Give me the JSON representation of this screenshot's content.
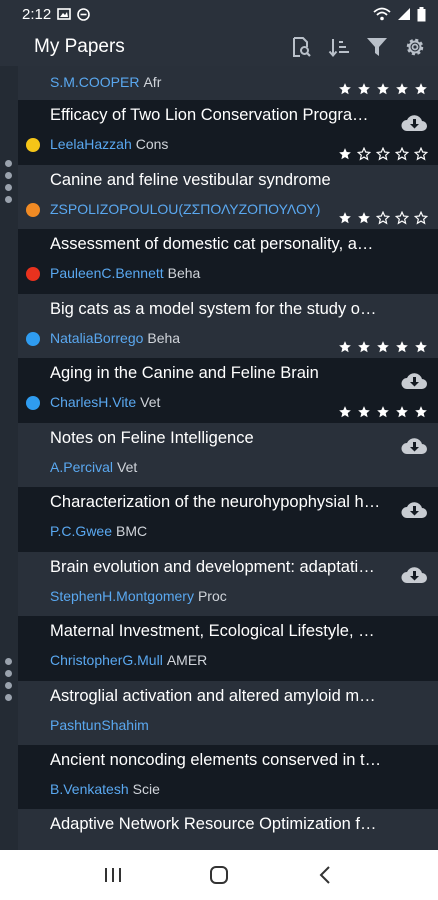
{
  "status_bar": {
    "time": "2:12"
  },
  "app_bar": {
    "title": "My Papers",
    "actions": [
      "search-doc-icon",
      "sort-icon",
      "filter-icon",
      "settings-icon"
    ]
  },
  "papers": [
    {
      "title": "",
      "author": "S.M.COOPER",
      "journal": "Afr",
      "dot": null,
      "rating": 5,
      "download": false
    },
    {
      "title": "Efficacy of Two Lion Conservation Progra…",
      "author": "LeelaHazzah",
      "journal": "Cons",
      "dot": "#f5c518",
      "rating": 1,
      "download": true
    },
    {
      "title": "Canine and feline vestibular syndrome",
      "author": "ZSPOLIZOPOULOU(ΖΣΠΟΛΥΖΟΠΟΥΛΟΥ)",
      "journal": "",
      "dot": "#f08a24",
      "rating": 2,
      "download": false
    },
    {
      "title": "Assessment of domestic cat personality, a…",
      "author": "PauleenC.Bennett",
      "journal": "Beha",
      "dot": "#e8321e",
      "rating": 0,
      "download": false
    },
    {
      "title": "Big cats as a model system for the study o…",
      "author": "NataliaBorrego",
      "journal": "Beha",
      "dot": "#2f9cf0",
      "rating": 5,
      "download": false
    },
    {
      "title": "Aging in the Canine and Feline Brain",
      "author": "CharlesH.Vite",
      "journal": "Vet",
      "dot": "#2f9cf0",
      "rating": 5,
      "download": true
    },
    {
      "title": "Notes on Feline Intelligence",
      "author": "A.Percival",
      "journal": "Vet",
      "dot": null,
      "rating": 0,
      "download": true
    },
    {
      "title": "Characterization of the neurohypophysial h…",
      "author": "P.C.Gwee",
      "journal": "BMC",
      "dot": null,
      "rating": 0,
      "download": true
    },
    {
      "title": "Brain evolution and development: adaptati…",
      "author": "StephenH.Montgomery",
      "journal": "Proc",
      "dot": null,
      "rating": 0,
      "download": true
    },
    {
      "title": "Maternal Investment, Ecological Lifestyle, …",
      "author": "ChristopherG.Mull",
      "journal": "AMER",
      "dot": null,
      "rating": 0,
      "download": false
    },
    {
      "title": "Astroglial activation and altered amyloid m…",
      "author": "PashtunShahim",
      "journal": "",
      "dot": null,
      "rating": 0,
      "download": false
    },
    {
      "title": "Ancient noncoding elements conserved in t…",
      "author": "B.Venkatesh",
      "journal": "Scie",
      "dot": null,
      "rating": 0,
      "download": false
    },
    {
      "title": "Adaptive Network Resource Optimization f…",
      "author": "",
      "journal": "",
      "dot": null,
      "rating": 0,
      "download": false
    }
  ],
  "colors": {
    "author": "#5aa8f0",
    "row_dark": "#141a22",
    "row_light": "#29303a",
    "bar": "#2a313b"
  }
}
